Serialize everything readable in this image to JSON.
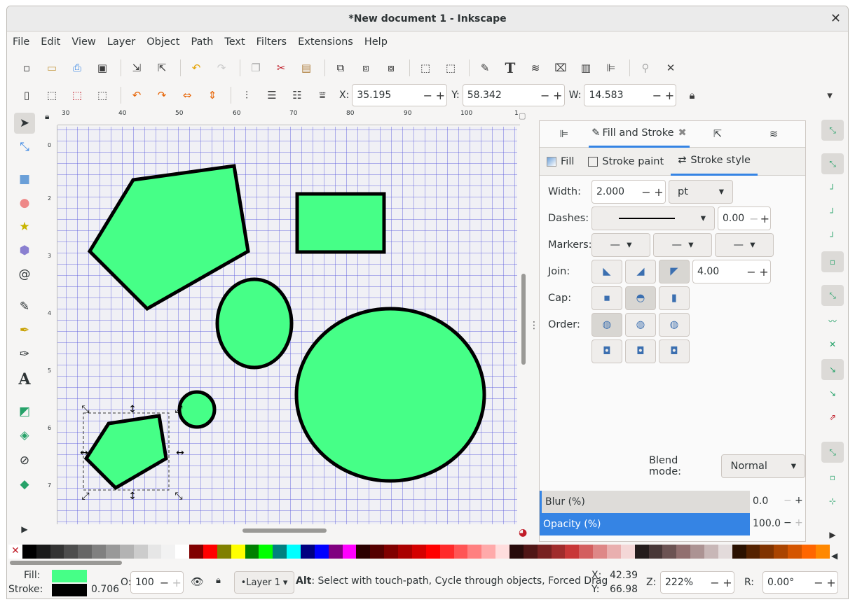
{
  "window": {
    "title": "*New document 1 - Inkscape",
    "close": "✕"
  },
  "menu": [
    "File",
    "Edit",
    "View",
    "Layer",
    "Object",
    "Path",
    "Text",
    "Filters",
    "Extensions",
    "Help"
  ],
  "toolbar2": {
    "x_label": "X:",
    "x_value": "35.195",
    "y_label": "Y:",
    "y_value": "58.342",
    "w_label": "W:",
    "w_value": "14.583"
  },
  "ruler_h": [
    "30",
    "40",
    "50",
    "60",
    "70",
    "80",
    "90",
    "100",
    "1"
  ],
  "ruler_v": [
    "0",
    "2",
    "3",
    "4",
    "5",
    "6",
    "7"
  ],
  "dock": {
    "tab_label": "Fill and Stroke",
    "subtabs": [
      "Fill",
      "Stroke paint",
      "Stroke style"
    ],
    "width_label": "Width:",
    "width_value": "2.000",
    "width_unit": "pt",
    "dashes_label": "Dashes:",
    "dash_offset": "0.00",
    "markers_label": "Markers:",
    "join_label": "Join:",
    "miter_limit": "4.00",
    "cap_label": "Cap:",
    "order_label": "Order:",
    "blend_label": "Blend mode:",
    "blend_value": "Normal",
    "blur_label": "Blur (%)",
    "blur_value": "0.0",
    "opacity_label": "Opacity (%)",
    "opacity_value": "100.0"
  },
  "status": {
    "fill_label": "Fill:",
    "stroke_label": "Stroke:",
    "stroke_width": "0.706",
    "opacity_label": "O:",
    "opacity_value": "100",
    "layer": "•Layer 1",
    "message_bold": "Alt",
    "message": ": Select with touch-path, Cycle through objects, Forced Drag",
    "cx_label": "X:",
    "cx": "42.39",
    "cy_label": "Y:",
    "cy": "66.98",
    "zoom_label": "Z:",
    "zoom": "222%",
    "rot_label": "R:",
    "rotation": "0.00°"
  },
  "colors": {
    "shape_fill": "#46ff87",
    "accent": "#3584e4"
  }
}
